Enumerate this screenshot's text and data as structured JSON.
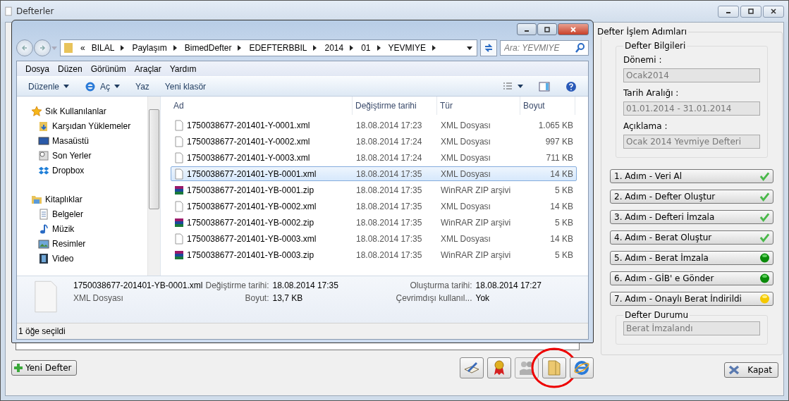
{
  "window": {
    "title": "Defterler"
  },
  "explorer": {
    "overflow_mark": "«",
    "breadcrumb": [
      "BILAL",
      "Paylaşım",
      "BimedDefter",
      "EDEFTERBBIL",
      "2014",
      "01",
      "YEVMIYE"
    ],
    "search": {
      "placeholder": "Ara: YEVMIYE"
    },
    "menu": [
      "Dosya",
      "Düzen",
      "Görünüm",
      "Araçlar",
      "Yardım"
    ],
    "toolbar": [
      {
        "label": "Düzenle",
        "kind": "dropdown"
      },
      {
        "label": "Aç",
        "kind": "open"
      },
      {
        "label": "Yaz",
        "kind": "plain"
      },
      {
        "label": "Yeni klasör",
        "kind": "plain"
      }
    ],
    "nav": [
      {
        "label": "Sık Kullanılanlar",
        "kind": "star",
        "children": [
          {
            "label": "Karşıdan Yüklemeler",
            "kind": "download"
          },
          {
            "label": "Masaüstü",
            "kind": "desktop"
          },
          {
            "label": "Son Yerler",
            "kind": "recent"
          },
          {
            "label": "Dropbox",
            "kind": "dropbox"
          }
        ]
      },
      {
        "label": "Kitaplıklar",
        "kind": "library",
        "children": [
          {
            "label": "Belgeler",
            "kind": "document"
          },
          {
            "label": "Müzik",
            "kind": "music"
          },
          {
            "label": "Resimler",
            "kind": "picture"
          },
          {
            "label": "Video",
            "kind": "video"
          }
        ]
      }
    ],
    "columns": [
      "Ad",
      "Değiştirme tarihi",
      "Tür",
      "Boyut"
    ],
    "files": [
      {
        "name": "1750038677-201401-Y-0001.xml",
        "modified": "18.08.2014 17:23",
        "type": "XML Dosyası",
        "size": "1.065 KB",
        "kind": "xml",
        "selected": false
      },
      {
        "name": "1750038677-201401-Y-0002.xml",
        "modified": "18.08.2014 17:24",
        "type": "XML Dosyası",
        "size": "997 KB",
        "kind": "xml",
        "selected": false
      },
      {
        "name": "1750038677-201401-Y-0003.xml",
        "modified": "18.08.2014 17:24",
        "type": "XML Dosyası",
        "size": "711 KB",
        "kind": "xml",
        "selected": false
      },
      {
        "name": "1750038677-201401-YB-0001.xml",
        "modified": "18.08.2014 17:35",
        "type": "XML Dosyası",
        "size": "14 KB",
        "kind": "xml",
        "selected": true
      },
      {
        "name": "1750038677-201401-YB-0001.zip",
        "modified": "18.08.2014 17:35",
        "type": "WinRAR ZIP arşivi",
        "size": "5 KB",
        "kind": "zip",
        "selected": false
      },
      {
        "name": "1750038677-201401-YB-0002.xml",
        "modified": "18.08.2014 17:35",
        "type": "XML Dosyası",
        "size": "14 KB",
        "kind": "xml",
        "selected": false
      },
      {
        "name": "1750038677-201401-YB-0002.zip",
        "modified": "18.08.2014 17:35",
        "type": "WinRAR ZIP arşivi",
        "size": "5 KB",
        "kind": "zip",
        "selected": false
      },
      {
        "name": "1750038677-201401-YB-0003.xml",
        "modified": "18.08.2014 17:35",
        "type": "XML Dosyası",
        "size": "14 KB",
        "kind": "xml",
        "selected": false
      },
      {
        "name": "1750038677-201401-YB-0003.zip",
        "modified": "18.08.2014 17:35",
        "type": "WinRAR ZIP arşivi",
        "size": "5 KB",
        "kind": "zip",
        "selected": false
      }
    ],
    "details": {
      "name": "1750038677-201401-YB-0001.xml",
      "type": "XML Dosyası",
      "fields": [
        {
          "label": "Değiştirme tarihi:",
          "value": "18.08.2014 17:35"
        },
        {
          "label": "Oluşturma tarihi:",
          "value": "18.08.2014 17:27"
        },
        {
          "label": "Boyut:",
          "value": "13,7 KB"
        },
        {
          "label": "Çevrimdışı kullanıl...",
          "value": "Yok"
        }
      ]
    },
    "status_bar": "1 öğe seçildi"
  },
  "new_button": "Yeni Defter",
  "tool_buttons": [
    {
      "kind": "book",
      "disabled": false,
      "highlighted": false
    },
    {
      "kind": "ribbon",
      "disabled": false,
      "highlighted": false
    },
    {
      "kind": "people",
      "disabled": true,
      "highlighted": false
    },
    {
      "kind": "folder",
      "disabled": false,
      "highlighted": true
    },
    {
      "kind": "browser",
      "disabled": false,
      "highlighted": false
    }
  ],
  "panel": {
    "title": "Defter İşlem Adımları",
    "info": {
      "title": "Defter Bilgileri",
      "fields": [
        {
          "label": "Dönemi :",
          "value": "Ocak2014"
        },
        {
          "label": "Tarih Aralığı :",
          "value": "01.01.2014 - 31.01.2014"
        },
        {
          "label": "Açıklama :",
          "value": "Ocak 2014 Yevmiye Defteri"
        }
      ]
    },
    "steps": [
      {
        "label": "1. Adım - Veri Al",
        "kind": "done"
      },
      {
        "label": "2. Adım - Defter Oluştur",
        "kind": "done"
      },
      {
        "label": "3. Adım - Defteri İmzala",
        "kind": "done"
      },
      {
        "label": "4. Adım - Berat Oluştur",
        "kind": "done"
      },
      {
        "label": "5. Adım - Berat İmzala",
        "kind": "green"
      },
      {
        "label": "6. Adım - GİB' e Gönder",
        "kind": "green"
      },
      {
        "label": "7. Adım - Onaylı Berat İndirildi",
        "kind": "yellow"
      }
    ],
    "status": {
      "title": "Defter Durumu",
      "value": "Berat İmzalandı"
    }
  },
  "close_button": "Kapat"
}
